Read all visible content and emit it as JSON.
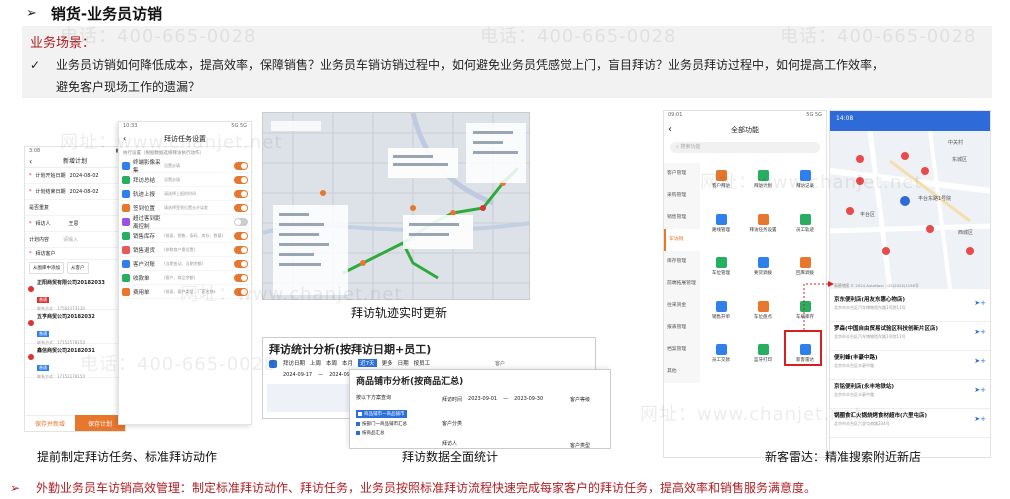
{
  "header": {
    "arrow": "➢",
    "title": "销货-业务员访销"
  },
  "scenario": {
    "label": "业务场景：",
    "check": "✓",
    "line1": "业务员访销如何降低成本，提高效率，保障销售？业务员车销访销过程中，如何避免业务员凭感觉上门，盲目拜访？业务员拜访过程中，如何提高工作效率，",
    "line2": "避免客户现场工作的遗漏？"
  },
  "watermarks": {
    "phone": "电话：400-665-0028",
    "site": "网址：www.chanjet.net"
  },
  "phone1": {
    "status_left": "3:08",
    "title": "新增计划",
    "rows": [
      {
        "label": "计划开始日期",
        "value": "2024-08-02"
      },
      {
        "label": "计划结束日期",
        "value": "2024-08-02"
      },
      {
        "label": "是否重复",
        "value": ""
      },
      {
        "label": "拜访人",
        "value": "王思"
      },
      {
        "label": "计划内容",
        "value": "请输入"
      }
    ],
    "customers_label": "拜访客户",
    "add_from_map": "从图库中添加",
    "add_customer": "从客户",
    "customers": [
      {
        "name": "正阳商贸有限公司20182033",
        "tag": "普通",
        "phone": "联系方式：17562173130"
      },
      {
        "name": "五亨商贸公司20182032",
        "tag": "普通",
        "phone": "联系方式：17152578150"
      },
      {
        "name": "鑫信商贸公司20182031",
        "tag": "普通",
        "phone": "联系方式：17152178150"
      }
    ],
    "save_new": "保存并新增",
    "save_plan": "保存计划"
  },
  "phone2": {
    "status_left": "10:33",
    "status_right": "5G 5G",
    "title": "拜访任务设置",
    "section": "执行设置（根据数据选择拜访执行动作）",
    "tasks": [
      {
        "label": "终端影像采集",
        "desc": "设置必填",
        "color": "#2f80ed",
        "on": true
      },
      {
        "label": "拜访总结",
        "desc": "设置必填",
        "color": "#27ae60",
        "on": true
      },
      {
        "label": "轨迹上报",
        "desc": "请选择上报的时间",
        "color": "#2f80ed",
        "on": true
      },
      {
        "label": "签到位置",
        "desc": "请选择签到位置允许误差",
        "color": "#e8772e",
        "on": true
      },
      {
        "label": "超过客到距离控制",
        "desc": "",
        "color": "#9b51e0",
        "on": false
      },
      {
        "label": "销售库存",
        "desc": "(前面、销售、条码、库存、数量)",
        "color": "#27ae60",
        "on": true
      },
      {
        "label": "销售退货",
        "desc": "(参数商户需设置)",
        "color": "#eb5757",
        "on": true
      },
      {
        "label": "客户对账",
        "desc": "(当期变动、当期余额)",
        "color": "#2f80ed",
        "on": true
      },
      {
        "label": "收款单",
        "desc": "(客户、商品余额)",
        "color": "#27ae60",
        "on": true
      },
      {
        "label": "费用单",
        "desc": "(前面、客户类型、厂家名称)",
        "color": "#e8772e",
        "on": true
      }
    ]
  },
  "captions": {
    "track": "拜访轨迹实时更新",
    "plan": "提前制定拜访任务、标准拜访动作",
    "stats": "拜访数据全面统计",
    "radar": "新客雷达：精准搜索附近新店"
  },
  "stats1": {
    "title": "拜访统计分析(按拜访日期+员工)",
    "filters": [
      "拜访日期",
      "上周",
      "本周",
      "本月",
      "近7天",
      "更多",
      "日期",
      "按员工"
    ],
    "date_from": "2024-09-17",
    "date_to": "2024-09-30",
    "customer_label": "客户"
  },
  "stats2": {
    "title": "商品铺市分析(按商品汇总)",
    "scheme": "按以下方案查询",
    "visit_time_label": "拜访时间",
    "date_from": "2023-09-01",
    "date_to": "2023-09-30",
    "customer_class_label": "客户分类",
    "customer_level_label": "客户等级",
    "visitor_label": "拜访人",
    "client_type_label": "客户类型",
    "schemes": [
      "商品铺市一商品铺市",
      "按部门一商品铺市汇总",
      "按商品汇总"
    ]
  },
  "phone3": {
    "status_left": "09:01",
    "status_right": "5G 5G",
    "title": "全部功能",
    "search": "搜索功能",
    "sidebar": [
      "客户管理",
      "采购管理",
      "销售管理",
      "车访销",
      "库存管理",
      "前端拓展管理",
      "往来资金",
      "报表管理",
      "档案管理",
      "其他"
    ],
    "items": [
      {
        "label": "客户拜访",
        "color": "#e8772e"
      },
      {
        "label": "拜访计划",
        "color": "#27ae60"
      },
      {
        "label": "拜访记录",
        "color": "#2f80ed"
      },
      {
        "label": "路线管理",
        "color": "#2f80ed"
      },
      {
        "label": "拜访任务设置",
        "color": "#e8772e"
      },
      {
        "label": "员工轨迹",
        "color": "#27ae60"
      },
      {
        "label": "车位管理",
        "color": "#27ae60"
      },
      {
        "label": "要货调拨",
        "color": "#2f80ed"
      },
      {
        "label": "回库调拨",
        "color": "#e8772e"
      },
      {
        "label": "销售开单",
        "color": "#2f80ed"
      },
      {
        "label": "车位盘点",
        "color": "#e8772e"
      },
      {
        "label": "车载库存",
        "color": "#27ae60"
      },
      {
        "label": "员工交款",
        "color": "#2f80ed"
      },
      {
        "label": "蓝牙打印",
        "color": "#27ae60"
      },
      {
        "label": "新客雷达",
        "color": "#2f80ed"
      }
    ]
  },
  "phone4": {
    "status_left": "14:08",
    "map_labels": [
      "中关村",
      "东城区",
      "丰台东路1号院",
      "丰台区",
      "西城区"
    ],
    "license": "高德地图 © 2024 AutoNavi - GS(2024)1158号",
    "places": [
      {
        "name": "京东便利店(用友东惠心物店)",
        "addr": "北京市丰台区汽车博物馆东路1号院11号"
      },
      {
        "name": "罗森(中国自由贸易试验区科技创新片区店)",
        "addr": "北京市丰台区汽车博物馆东路1号院11号"
      },
      {
        "name": "便利蜂(丰豪中路)",
        "addr": "北京市丰台区丰豪中路"
      },
      {
        "name": "京铭便利店(永丰地铁站)",
        "addr": "北京市丰台区丰豪中路"
      },
      {
        "name": "锅圈食汇火锅烧烤食材超市(六里屯店)",
        "addr": "北京市丰台区六里屯南路204号"
      }
    ]
  },
  "footer": {
    "arrow": "➢",
    "text": "外勤业务员车访销高效管理：制定标准拜访动作、拜访任务，业务员按照标准拜访流程快速完成每家客户的拜访任务，提高效率和销售服务满意度。"
  }
}
